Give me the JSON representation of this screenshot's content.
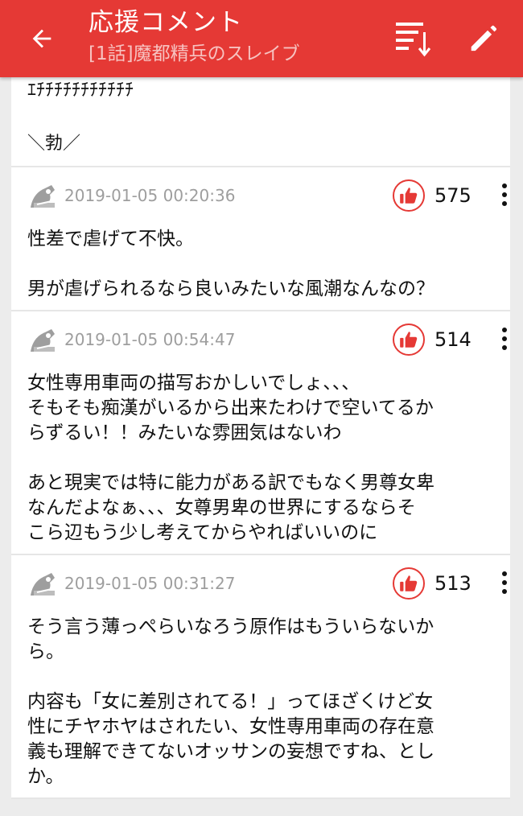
{
  "header": {
    "title": "応援コメント",
    "subtitle": "[1話]魔都精兵のスレイブ"
  },
  "partial_comment": {
    "line1": "ｴﾁﾁﾁﾁﾁﾁﾁﾁﾁﾁﾁ",
    "line2": "＼勃／"
  },
  "comments": [
    {
      "date": "2019-01-05 00:20:36",
      "likes": "575",
      "text": "性差で虐げて不快。\n\n男が虐げられるなら良いみたいな風潮なんなの？"
    },
    {
      "date": "2019-01-05 00:54:47",
      "likes": "514",
      "text": "女性専用車両の描写おかしいでしょ、、、\nそもそも痴漢がいるから出来たわけで空いてるか\nらずるい！！みたいな雰囲気はないわ\n\nあと現実では特に能力がある訳でもなく男尊女卑\nなんだよなぁ、、、女尊男卑の世界にするならそ\nこら辺もう少し考えてからやればいいのに"
    },
    {
      "date": "2019-01-05 00:31:27",
      "likes": "513",
      "text": "そう言う薄っぺらいなろう原作はもういらないか\nら。\n\n内容も「女に差別されてる！」ってほざくけど女\n性にチヤホヤはされたい、女性専用車両の存在意\n義も理解できてないオッサンの妄想ですね、とし\nか。"
    }
  ],
  "colors": {
    "appbar": "#e53935",
    "like_ring": "#e53935",
    "date_text": "#9e9e9e"
  },
  "icons": {
    "back": "arrow-back-icon",
    "sort": "sort-icon",
    "edit": "pencil-icon",
    "like": "thumbs-up-icon",
    "more": "more-vertical-icon",
    "avatar": "anonymous-avatar-icon"
  }
}
